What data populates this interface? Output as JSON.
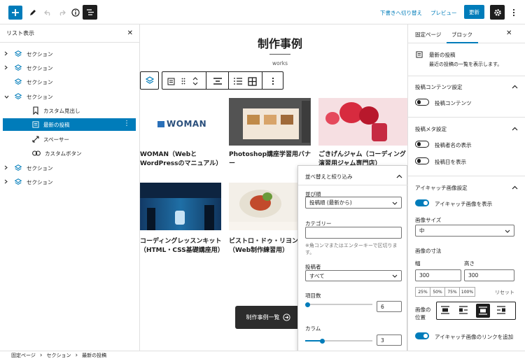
{
  "topbar": {
    "save_draft_label": "下書きへ切り替え",
    "preview_label": "プレビュー",
    "update_label": "更新"
  },
  "list_view": {
    "title": "リスト表示",
    "items": [
      {
        "label": "セクション"
      },
      {
        "label": "セクション"
      },
      {
        "label": "セクション"
      },
      {
        "label": "セクション"
      },
      {
        "label": "カスタム見出し"
      },
      {
        "label": "最新の投稿"
      },
      {
        "label": "スペーサー"
      },
      {
        "label": "カスタムボタン"
      },
      {
        "label": "セクション"
      },
      {
        "label": "セクション"
      }
    ]
  },
  "canvas": {
    "heading": "制作事例",
    "subheading": "works",
    "posts": [
      {
        "title": "WOMAN（WebとWordPressのマニュアル）",
        "logo_text": "WOMAN"
      },
      {
        "title": "Photoshop講座学習用バナー"
      },
      {
        "title": "ごきげんジャム（コーディング演習用ジャム専門店）"
      },
      {
        "title": "コーディングレッスンキット（HTML・CSS基礎講座用）"
      },
      {
        "title": "ビストロ・ドゥ・リヨン（Web制作練習用）"
      }
    ],
    "more_button": "制作事例一覧"
  },
  "sort_popover": {
    "title": "並べ替えと絞り込み",
    "order_label": "並び順",
    "order_value": "投稿順 (最新から)",
    "category_label": "カテゴリー",
    "category_value": "",
    "category_help": "※角コンマまたはエンターキーで区切ります。",
    "author_label": "投稿者",
    "author_value": "すべて",
    "count_label": "項目数",
    "count_value": "6",
    "count_level": 0.0,
    "columns_label": "カラム",
    "columns_value": "3",
    "columns_level": 0.25
  },
  "settings": {
    "tab_page": "固定ページ",
    "tab_block": "ブロック",
    "block_name": "最新の投稿",
    "block_desc": "最近の投稿の一覧を表示します。",
    "content_section": {
      "title": "投稿コンテンツ設定",
      "toggle_label": "投稿コンテンツ",
      "on": false
    },
    "meta_section": {
      "title": "投稿メタ設定",
      "author_label": "投稿者名の表示",
      "author_on": false,
      "date_label": "投稿日を表示",
      "date_on": false
    },
    "image_section": {
      "title": "アイキャッチ画像設定",
      "show_label": "アイキャッチ画像を表示",
      "show_on": true,
      "size_label": "画像サイズ",
      "size_value": "中",
      "dims_label": "画像の寸法",
      "width_label": "幅",
      "width_value": "300",
      "height_label": "高さ",
      "height_value": "300",
      "percents": [
        "25%",
        "50%",
        "75%",
        "100%"
      ],
      "reset_label": "リセット",
      "align_label": "画像の位置",
      "link_label": "アイキャッチ画像のリンクを追加",
      "link_on": true
    }
  },
  "breadcrumb": [
    "固定ページ",
    "セクション",
    "最新の投稿"
  ],
  "colors": {
    "accent": "#007cba",
    "dark": "#1e1e1e",
    "button_dark": "#2c2c2c"
  }
}
